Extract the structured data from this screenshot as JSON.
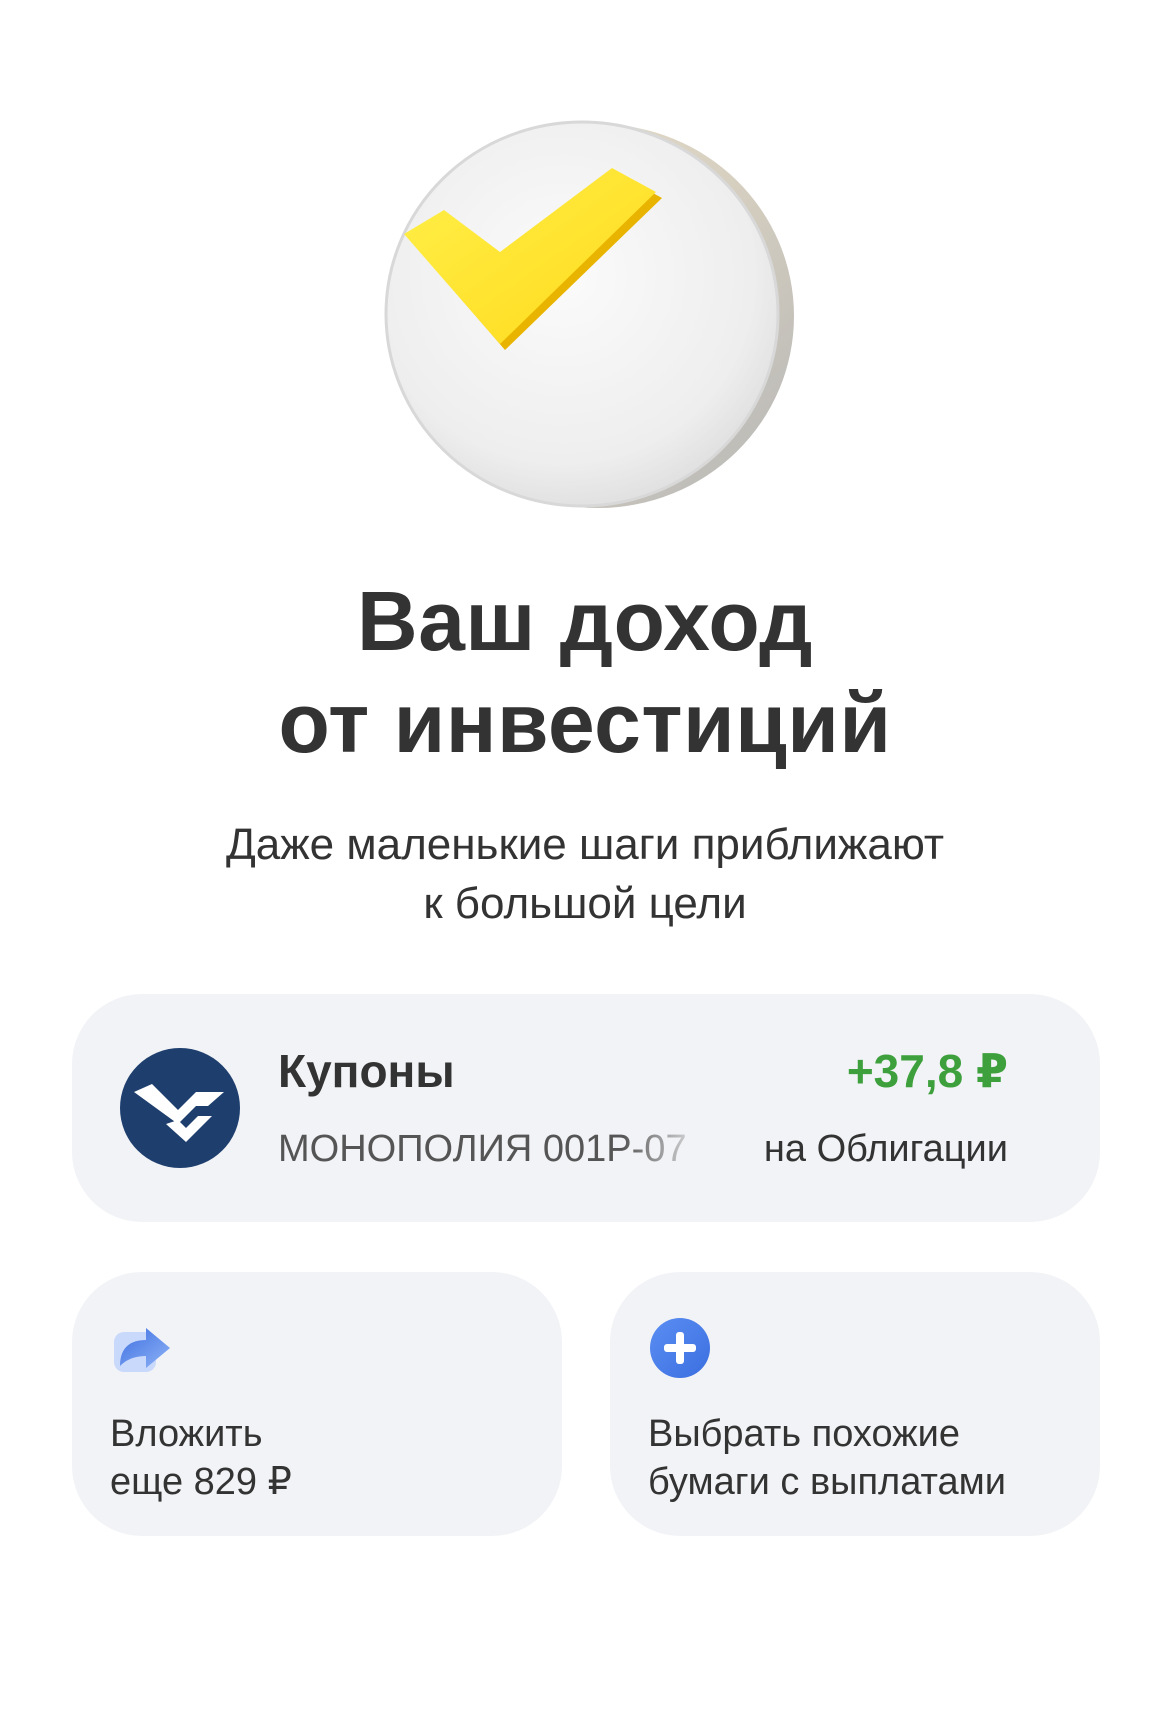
{
  "hero": {
    "icon": "yellow-checkmark-coin-icon",
    "colors": {
      "check": "#ffe01b",
      "coin": "#f2f2f2"
    }
  },
  "title": {
    "line1": "Ваш доход",
    "line2": "от инвестиций"
  },
  "subtitle": {
    "line1": "Даже маленькие шаги приближают",
    "line2": "к большой цели"
  },
  "coupon_card": {
    "label": "Купоны",
    "amount": "+37,8 ₽",
    "amount_color": "#3da03d",
    "bond_name": "МОНОПОЛИЯ 001Р-07",
    "bond_type": "на Облигации",
    "logo_icon": "monopoly-bond-logo",
    "logo_color": "#1e3f6e"
  },
  "actions": {
    "invest": {
      "icon": "share-arrow-icon",
      "line1": "Вложить",
      "line2": "еще 829 ₽"
    },
    "similar": {
      "icon": "plus-circle-icon",
      "line1": "Выбрать похожие",
      "line2": "бумаги с выплатами"
    }
  }
}
